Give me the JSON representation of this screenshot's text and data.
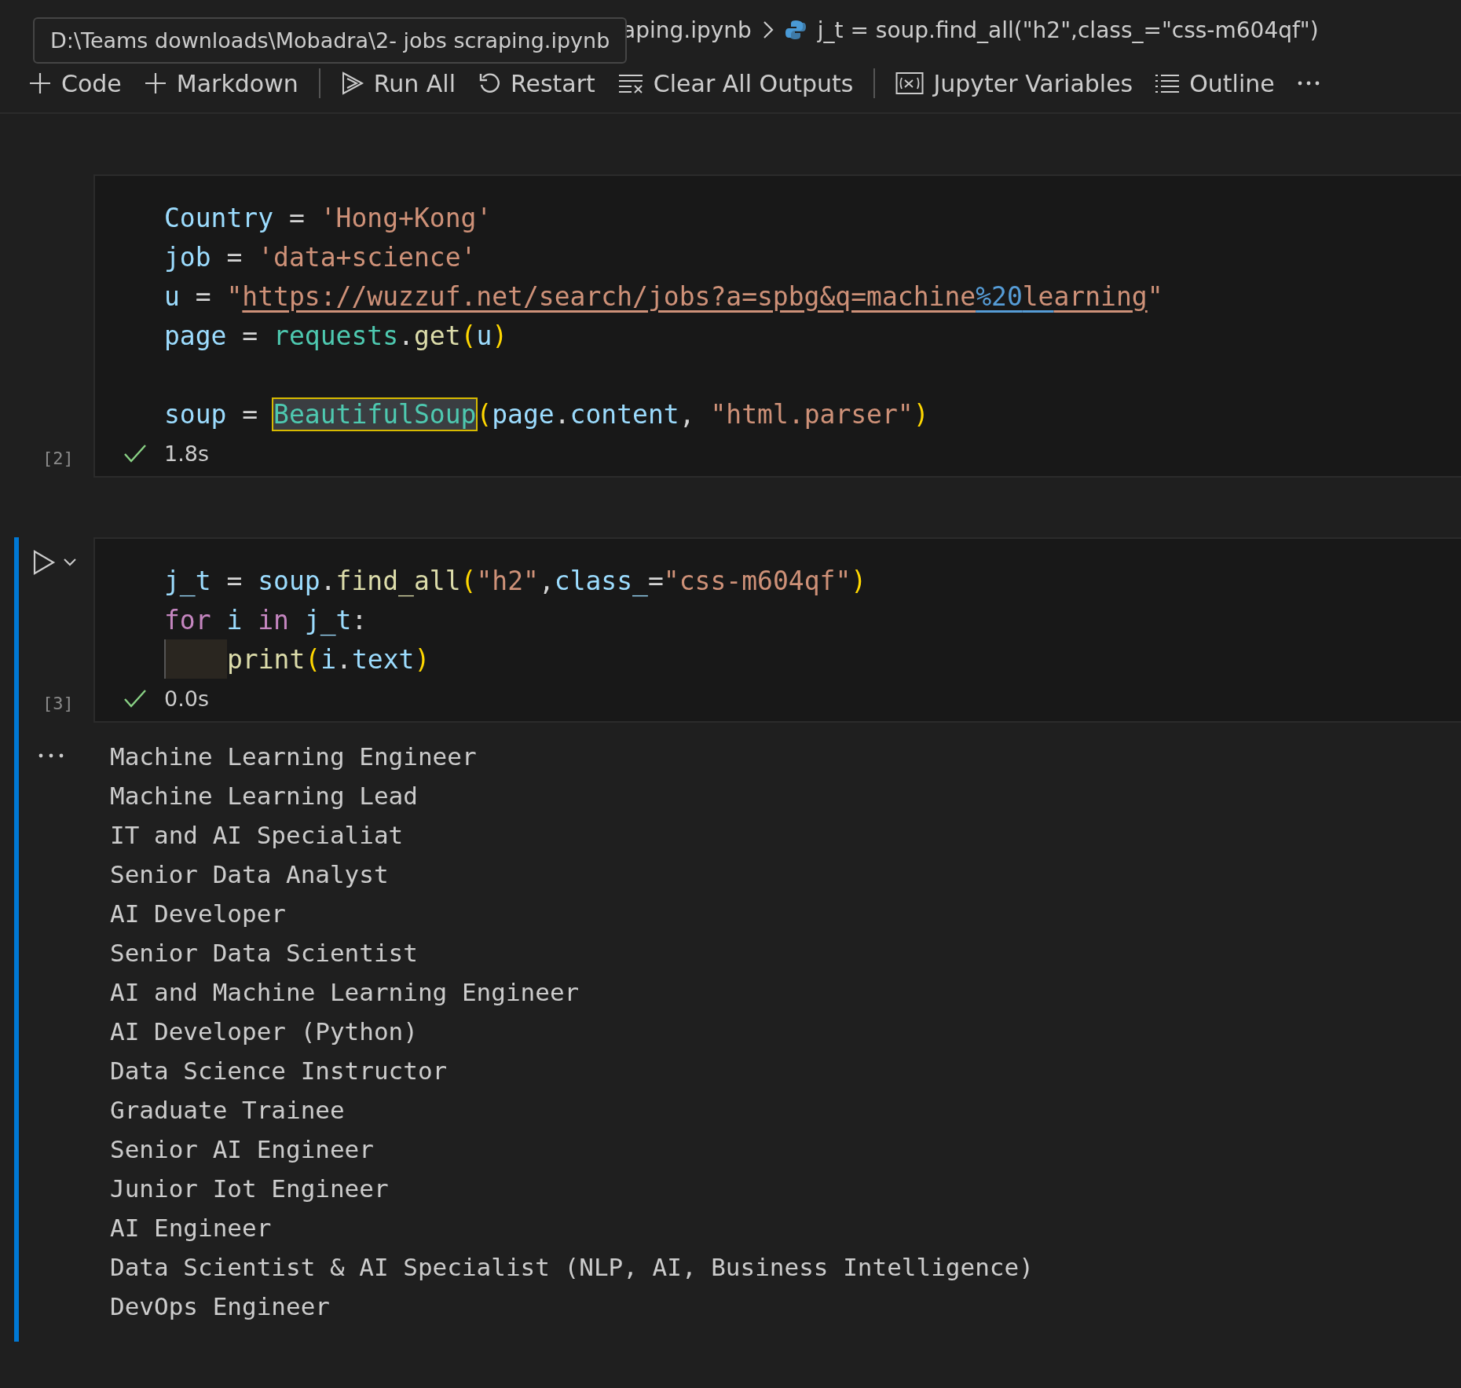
{
  "breadcrumb": {
    "file": "aping.ipynb",
    "symbol": "j_t = soup.find_all(\"h2\",class_=\"css-m604qf\")",
    "tooltip": "D:\\Teams downloads\\Mobadra\\2- jobs scraping.ipynb"
  },
  "toolbar": [
    {
      "kind": "plus",
      "label": "Code"
    },
    {
      "kind": "plus",
      "label": "Markdown"
    },
    {
      "kind": "separator"
    },
    {
      "kind": "run-all",
      "label": "Run All"
    },
    {
      "kind": "restart",
      "label": "Restart"
    },
    {
      "kind": "clear",
      "label": "Clear All Outputs"
    },
    {
      "kind": "separator"
    },
    {
      "kind": "variables",
      "label": "Jupyter Variables"
    },
    {
      "kind": "outline",
      "label": "Outline"
    },
    {
      "kind": "more"
    }
  ],
  "cells": [
    {
      "execution_count": "[2]",
      "succeeded": true,
      "duration": "1.8s",
      "focused": false,
      "lines": [
        {
          "kind": "code",
          "tokens": [
            {
              "kind": "var",
              "text": "Country"
            },
            {
              "kind": "op",
              "text": " = "
            },
            {
              "kind": "str",
              "text": "'Hong+Kong'"
            }
          ]
        },
        {
          "kind": "code",
          "tokens": [
            {
              "kind": "var",
              "text": "job"
            },
            {
              "kind": "op",
              "text": " = "
            },
            {
              "kind": "str",
              "text": "'data+science'"
            }
          ]
        },
        {
          "kind": "code",
          "tokens": [
            {
              "kind": "var",
              "text": "u"
            },
            {
              "kind": "op",
              "text": " = "
            },
            {
              "kind": "str",
              "text": "\""
            },
            {
              "kind": "url",
              "text": "https://wuzzuf.net/search/jobs?a=spbg&q=machine"
            },
            {
              "kind": "escape",
              "text": "%20"
            },
            {
              "kind": "url-mark",
              "text": "le"
            },
            {
              "kind": "url",
              "text": "arning"
            },
            {
              "kind": "str",
              "text": "\""
            }
          ]
        },
        {
          "kind": "code",
          "tokens": [
            {
              "kind": "var",
              "text": "page"
            },
            {
              "kind": "op",
              "text": " = "
            },
            {
              "kind": "cls",
              "text": "requests"
            },
            {
              "kind": "op",
              "text": "."
            },
            {
              "kind": "fn",
              "text": "get"
            },
            {
              "kind": "bracket",
              "text": "("
            },
            {
              "kind": "var",
              "text": "u"
            },
            {
              "kind": "bracket",
              "text": ")"
            }
          ]
        },
        {
          "kind": "blank"
        },
        {
          "kind": "code",
          "tokens": [
            {
              "kind": "var",
              "text": "soup"
            },
            {
              "kind": "op",
              "text": " = "
            },
            {
              "kind": "cls-match",
              "text": "BeautifulSoup"
            },
            {
              "kind": "bracket",
              "text": "("
            },
            {
              "kind": "var",
              "text": "page"
            },
            {
              "kind": "op",
              "text": "."
            },
            {
              "kind": "var",
              "text": "content"
            },
            {
              "kind": "op",
              "text": ", "
            },
            {
              "kind": "str",
              "text": "\"html.parser\""
            },
            {
              "kind": "bracket",
              "text": ")"
            }
          ]
        }
      ]
    },
    {
      "execution_count": "[3]",
      "succeeded": true,
      "duration": "0.0s",
      "focused": true,
      "lines": [
        {
          "kind": "code",
          "tokens": [
            {
              "kind": "var",
              "text": "j_t"
            },
            {
              "kind": "op",
              "text": " = "
            },
            {
              "kind": "var",
              "text": "soup"
            },
            {
              "kind": "op",
              "text": "."
            },
            {
              "kind": "fn",
              "text": "find_all"
            },
            {
              "kind": "bracket",
              "text": "("
            },
            {
              "kind": "str",
              "text": "\"h2\""
            },
            {
              "kind": "op",
              "text": ","
            },
            {
              "kind": "var",
              "text": "class_"
            },
            {
              "kind": "op",
              "text": "="
            },
            {
              "kind": "str",
              "text": "\"css-m604qf\""
            },
            {
              "kind": "bracket",
              "text": ")"
            }
          ]
        },
        {
          "kind": "code",
          "tokens": [
            {
              "kind": "kw",
              "text": "for"
            },
            {
              "kind": "var",
              "text": " i "
            },
            {
              "kind": "kw",
              "text": "in"
            },
            {
              "kind": "var",
              "text": " j_t"
            },
            {
              "kind": "op",
              "text": ":"
            }
          ]
        },
        {
          "kind": "code",
          "tokens": [
            {
              "kind": "indent"
            },
            {
              "kind": "fn",
              "text": "print"
            },
            {
              "kind": "bracket",
              "text": "("
            },
            {
              "kind": "var",
              "text": "i"
            },
            {
              "kind": "op",
              "text": "."
            },
            {
              "kind": "var",
              "text": "text"
            },
            {
              "kind": "bracket",
              "text": ")"
            }
          ]
        }
      ],
      "output": {
        "lines": [
          "Machine Learning Engineer",
          "Machine Learning Lead",
          "IT and AI Specialiat",
          "Senior Data Analyst",
          "AI Developer",
          "Senior Data Scientist",
          "AI and Machine Learning Engineer",
          "AI Developer (Python)",
          "Data Science Instructor",
          "Graduate Trainee",
          "Senior AI Engineer",
          "Junior Iot Engineer",
          "AI Engineer",
          "Data Scientist & AI Specialist (NLP, AI, Business Intelligence)",
          "DevOps Engineer"
        ]
      }
    }
  ]
}
